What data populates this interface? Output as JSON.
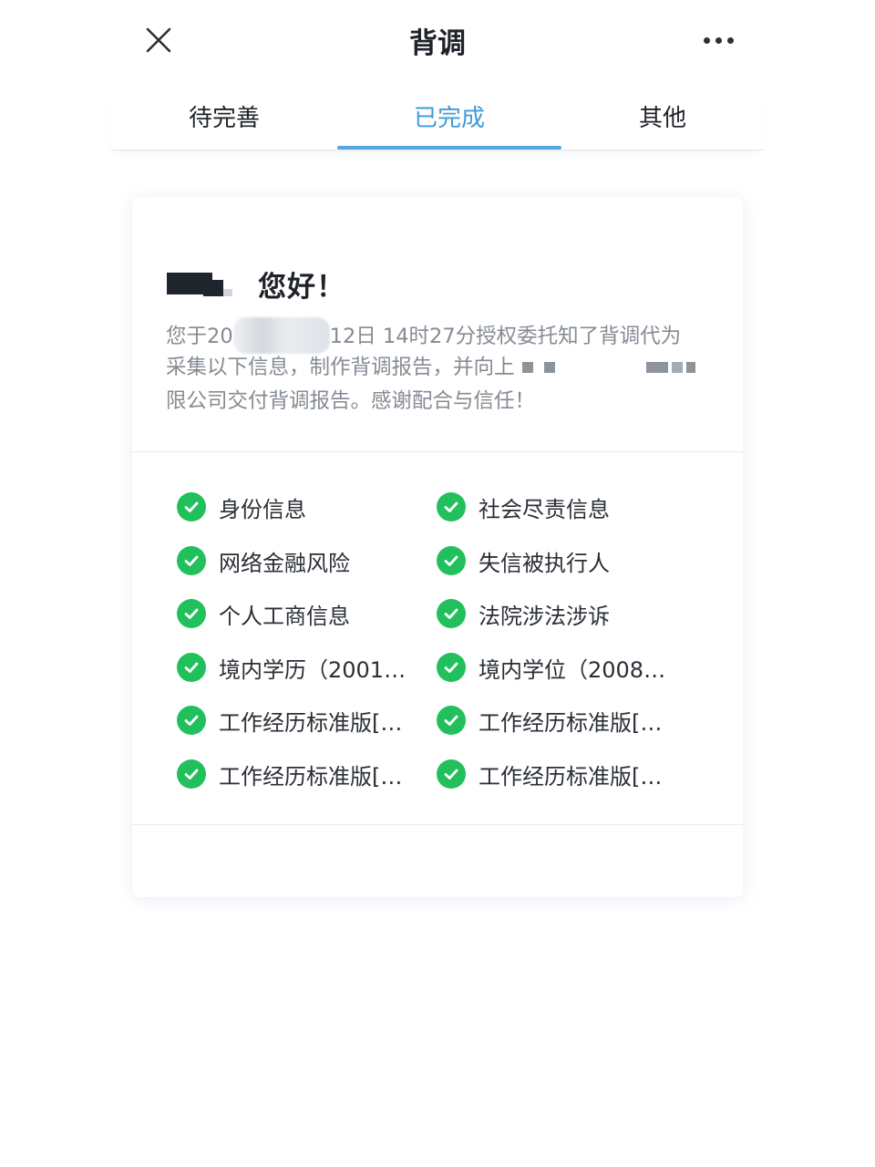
{
  "nav": {
    "title": "背调",
    "close_icon": "close-icon",
    "more_icon": "more-horizontal-icon"
  },
  "tabs": [
    {
      "label": "待完善",
      "active": false
    },
    {
      "label": "已完成",
      "active": true
    },
    {
      "label": "其他",
      "active": false
    }
  ],
  "colors": {
    "accent": "#3f9bd9",
    "check": "#22c05c",
    "muted_text": "#858b94"
  },
  "card": {
    "greeting": "您好！",
    "intro": {
      "line1_a": "您于20",
      "line1_b": "12日 14时27分授权委托知了背调代为",
      "line2": "采集以下信息，制作背调报告，并向上",
      "line3": "限公司交付背调报告。感谢配合与信任！"
    },
    "items": [
      {
        "label": "身份信息",
        "icon": "check-circle-icon"
      },
      {
        "label": "社会尽责信息",
        "icon": "check-circle-icon"
      },
      {
        "label": "网络金融风险",
        "icon": "check-circle-icon"
      },
      {
        "label": "失信被执行人",
        "icon": "check-circle-icon"
      },
      {
        "label": "个人工商信息",
        "icon": "check-circle-icon"
      },
      {
        "label": "法院涉法涉诉",
        "icon": "check-circle-icon"
      },
      {
        "label": "境内学历（2001…",
        "icon": "check-circle-icon"
      },
      {
        "label": "境内学位（2008…",
        "icon": "check-circle-icon"
      },
      {
        "label": "工作经历标准版[…",
        "icon": "check-circle-icon"
      },
      {
        "label": "工作经历标准版[…",
        "icon": "check-circle-icon"
      },
      {
        "label": "工作经历标准版[…",
        "icon": "check-circle-icon"
      },
      {
        "label": "工作经历标准版[…",
        "icon": "check-circle-icon"
      }
    ]
  }
}
